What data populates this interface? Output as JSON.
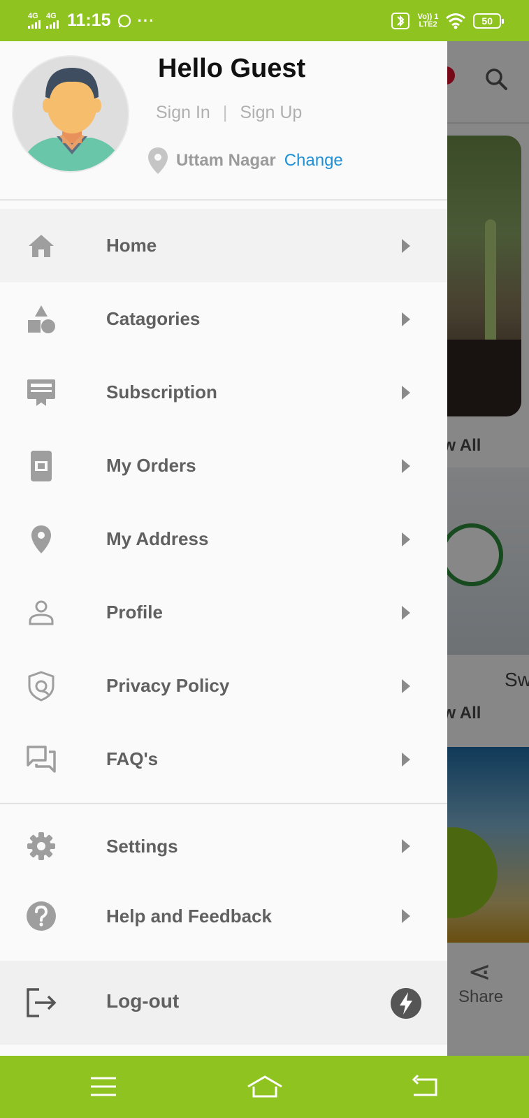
{
  "status_bar": {
    "network_1": "4G",
    "network_2": "4G",
    "time": "11:15",
    "more": "···",
    "volte": "Vo)) 1",
    "lte": "LTE2",
    "battery": "50"
  },
  "drawer": {
    "greeting": "Hello Guest",
    "sign_in": "Sign In",
    "separator": "|",
    "sign_up": "Sign Up",
    "location": "Uttam Nagar",
    "change": "Change",
    "menu": [
      {
        "label": "Home",
        "icon": "home-icon"
      },
      {
        "label": "Catagories",
        "icon": "categories-icon"
      },
      {
        "label": "Subscription",
        "icon": "subscription-icon"
      },
      {
        "label": "My Orders",
        "icon": "orders-icon"
      },
      {
        "label": "My Address",
        "icon": "location-pin-icon"
      },
      {
        "label": "Profile",
        "icon": "person-icon"
      },
      {
        "label": "Privacy Policy",
        "icon": "shield-icon"
      },
      {
        "label": "FAQ's",
        "icon": "chat-icon"
      }
    ],
    "secondary_menu": [
      {
        "label": "Settings",
        "icon": "gear-icon"
      },
      {
        "label": "Help and Feedback",
        "icon": "help-icon"
      }
    ],
    "logout": "Log-out"
  },
  "background": {
    "view_all_1": "ew All",
    "view_all_2": "ew All",
    "product_title_partial": "Sw",
    "share": "Share"
  },
  "colors": {
    "brand_green": "#8fc31f",
    "link_blue": "#1e90d6"
  }
}
